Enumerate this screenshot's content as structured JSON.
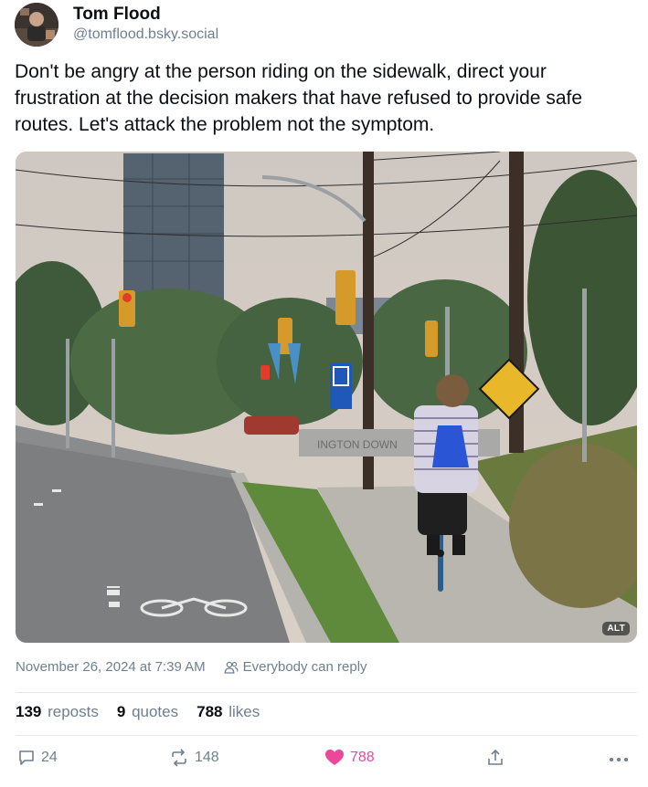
{
  "author": {
    "display_name": "Tom Flood",
    "handle": "@tomflood.bsky.social"
  },
  "post": {
    "text": "Don't be angry at the person riding on the sidewalk, direct your frustration at the decision makers that have refused to provide safe routes. Let's attack the problem not the symptom.",
    "image_alt_badge": "ALT",
    "image_sign_text": "INGTON DOWN"
  },
  "meta": {
    "timestamp": "November 26, 2024 at 7:39 AM",
    "reply_setting": "Everybody can reply"
  },
  "stats": {
    "reposts_count": "139",
    "reposts_label": "reposts",
    "quotes_count": "9",
    "quotes_label": "quotes",
    "likes_count": "788",
    "likes_label": "likes"
  },
  "actions": {
    "reply_count": "24",
    "repost_count": "148",
    "like_count": "788"
  },
  "colors": {
    "like_active": "#ec4899",
    "muted_text": "#6f7f8f",
    "primary_text": "#0b0f14"
  }
}
